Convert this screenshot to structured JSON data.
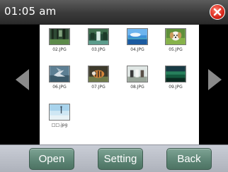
{
  "header": {
    "time": "01:05 am",
    "close_icon": "close-icon"
  },
  "navigation": {
    "prev_icon": "chevron-left-icon",
    "next_icon": "chevron-right-icon"
  },
  "gallery": {
    "items": [
      {
        "label": "02.JPG",
        "thumb": "forest-photo"
      },
      {
        "label": "03.JPG",
        "thumb": "waterfall-photo"
      },
      {
        "label": "04.JPG",
        "thumb": "ocean-sky-photo"
      },
      {
        "label": "05.JPG",
        "thumb": "puppy-photo"
      },
      {
        "label": "06.JPG",
        "thumb": "bird-photo"
      },
      {
        "label": "07.JPG",
        "thumb": "tiger-photo"
      },
      {
        "label": "08.JPG",
        "thumb": "horses-photo"
      },
      {
        "label": "09.JPG",
        "thumb": "landscape-photo"
      },
      {
        "label": "□□.jpg",
        "thumb": "sky-photo"
      }
    ]
  },
  "toolbar": {
    "open_label": "Open",
    "setting_label": "Setting",
    "back_label": "Back"
  },
  "colors": {
    "button": "#5c8474",
    "close": "#d8261a",
    "toolbar_bg": "#bcc0c9"
  }
}
